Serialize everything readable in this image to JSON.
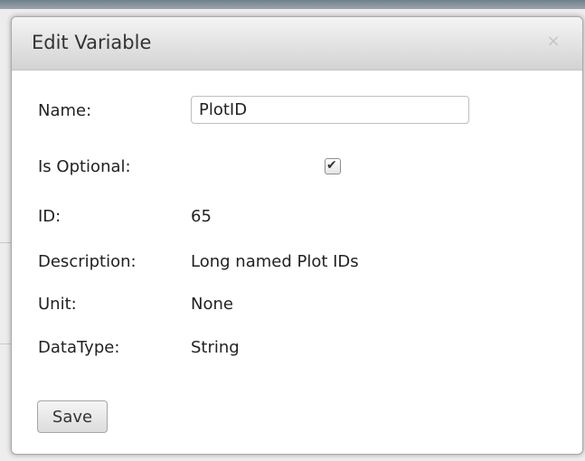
{
  "dialog": {
    "title": "Edit Variable",
    "close_label": "×",
    "fields": {
      "name_label": "Name:",
      "name_value": "PlotID",
      "optional_label": "Is Optional:",
      "optional_checked": true,
      "id_label": "ID:",
      "id_value": "65",
      "description_label": "Description:",
      "description_value": "Long named Plot IDs",
      "unit_label": "Unit:",
      "unit_value": "None",
      "datatype_label": "DataType:",
      "datatype_value": "String"
    },
    "save_label": "Save"
  },
  "colors": {
    "titlebar": "#e2e2e2",
    "dialog_bg": "#ffffff",
    "text": "#222222",
    "close_icon": "#c4c4c4"
  },
  "icons": {
    "close": "close-icon",
    "check": "checkmark-icon"
  }
}
